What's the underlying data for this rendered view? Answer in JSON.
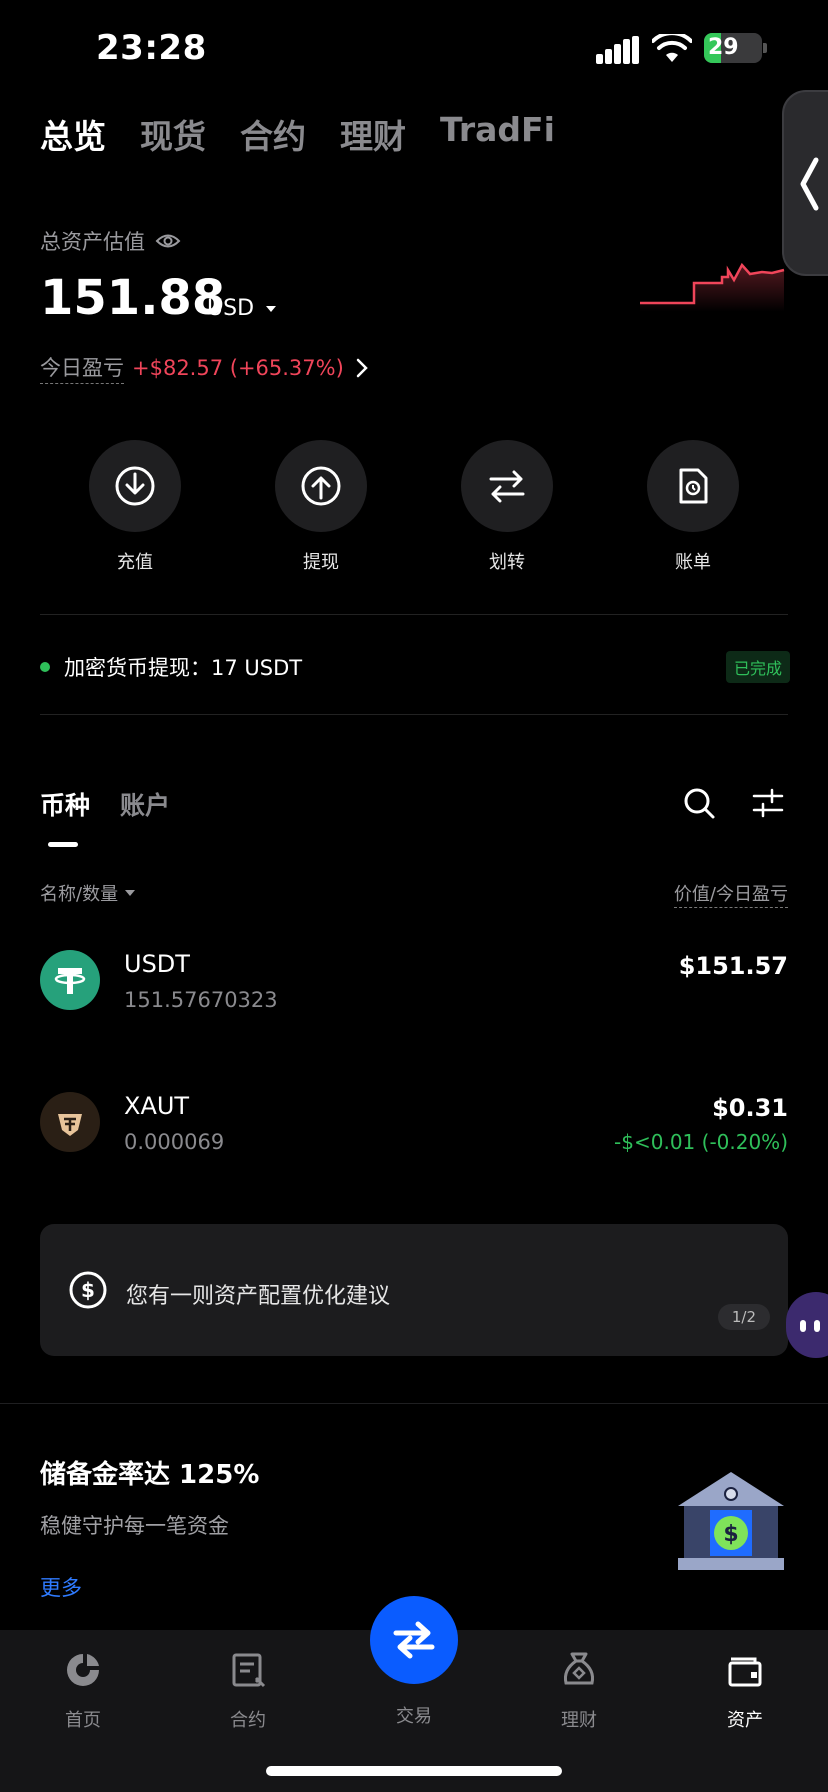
{
  "status_bar": {
    "time": "23:28",
    "battery": "29"
  },
  "top_tabs": [
    "总览",
    "现货",
    "合约",
    "理财",
    "TradFi"
  ],
  "assets": {
    "label": "总资产估值",
    "value": "151.88",
    "currency": "USD",
    "pnl_label": "今日盈亏",
    "pnl_value": "+$82.57 (+65.37%)"
  },
  "actions": [
    {
      "label": "充值",
      "icon": "deposit-icon"
    },
    {
      "label": "提现",
      "icon": "withdraw-icon"
    },
    {
      "label": "划转",
      "icon": "transfer-icon"
    },
    {
      "label": "账单",
      "icon": "bill-icon"
    }
  ],
  "notice": {
    "text": "加密货币提现：17 USDT",
    "status": "已完成"
  },
  "coin_tabs": [
    "币种",
    "账户"
  ],
  "columns": {
    "left": "名称/数量",
    "right": "价值/今日盈亏"
  },
  "coins": [
    {
      "name": "USDT",
      "qty": "151.57670323",
      "value": "$151.57",
      "change": ""
    },
    {
      "name": "XAUT",
      "qty": "0.000069",
      "value": "$0.31",
      "change": "-$<0.01 (-0.20%)"
    }
  ],
  "suggestion": {
    "text": "您有一则资产配置优化建议",
    "page": "1/2"
  },
  "reserve": {
    "title": "储备金率达 125%",
    "subtitle": "稳健守护每一笔资金",
    "more": "更多"
  },
  "bottom_nav": [
    "首页",
    "合约",
    "交易",
    "理财",
    "资产"
  ],
  "colors": {
    "profit": "#f0455a",
    "loss_green": "#2fbf5a",
    "accent": "#0a5cff",
    "link": "#2f7bff"
  }
}
